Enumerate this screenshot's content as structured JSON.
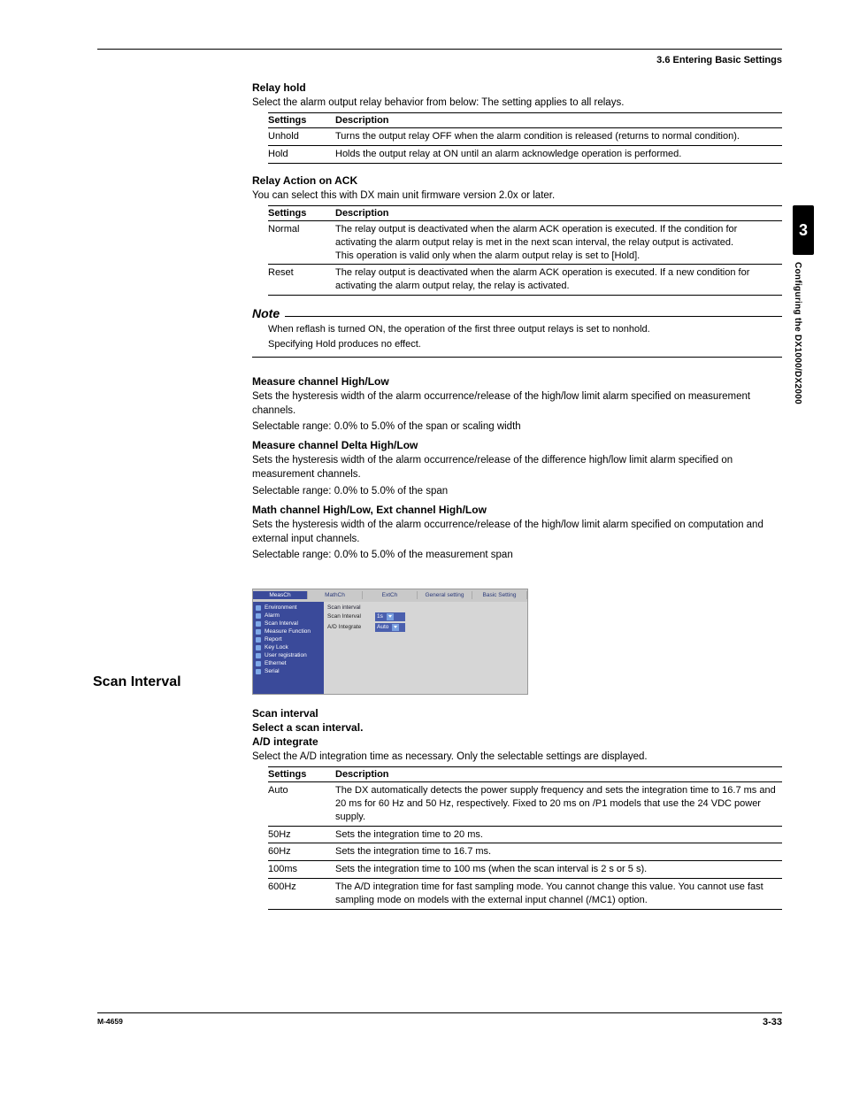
{
  "header": {
    "section": "3.6  Entering Basic Settings"
  },
  "chapter": {
    "num": "3",
    "sideText": "Configuring the DX1000/DX2000"
  },
  "relayHold": {
    "title": "Relay hold",
    "intro": "Select the alarm output relay behavior from below: The setting applies to all relays.",
    "cols": {
      "a": "Settings",
      "b": "Description"
    },
    "rows": [
      {
        "a": "Unhold",
        "b": "Turns the output relay OFF when the alarm condition is released (returns to normal condition)."
      },
      {
        "a": "Hold",
        "b": "Holds the output relay at ON until an alarm acknowledge operation is performed."
      }
    ]
  },
  "relayAck": {
    "title": "Relay Action on ACK",
    "intro": "You can select this with DX main unit firmware version 2.0x or later.",
    "cols": {
      "a": "Settings",
      "b": "Description"
    },
    "rows": [
      {
        "a": "Normal",
        "b": "The relay output is deactivated when the alarm ACK operation is executed. If the condition for activating the alarm output relay is met in the next scan interval, the relay output is activated.\nThis operation is valid only when the alarm output relay is set to [Hold]."
      },
      {
        "a": "Reset",
        "b": "The relay output is deactivated when the alarm ACK operation is executed. If a new condition for activating the alarm output relay, the relay is activated."
      }
    ]
  },
  "note": {
    "label": "Note",
    "line1": "When reflash is turned ON, the operation of the first three output relays is set to nonhold.",
    "line2": "Specifying Hold produces no effect."
  },
  "measHL": {
    "title": "Measure channel High/Low",
    "p1": "Sets the hysteresis width of the alarm occurrence/release of the high/low limit alarm specified on measurement channels.",
    "p2": "Selectable range: 0.0% to 5.0% of the span or scaling width"
  },
  "measDHL": {
    "title": "Measure channel Delta High/Low",
    "p1": "Sets the hysteresis width of the alarm occurrence/release of the difference high/low limit alarm specified on measurement channels.",
    "p2": "Selectable range: 0.0% to 5.0% of the span"
  },
  "mathHL": {
    "title": "Math channel High/Low, Ext channel High/Low",
    "p1": "Sets the hysteresis width of the alarm occurrence/release of the high/low limit alarm specified on computation and external input channels.",
    "p2": "Selectable range: 0.0% to 5.0% of the measurement span"
  },
  "scan": {
    "heading": "Scan Interval",
    "shot": {
      "tabs": [
        "MeasCh",
        "MathCh",
        "ExtCh",
        "General setting",
        "Basic Setting"
      ],
      "activeTab": 0,
      "side": [
        "Environment",
        "Alarm",
        "Scan Interval",
        "Measure Function",
        "Report",
        "Key Lock",
        "User registration",
        "Ethernet",
        "Serial"
      ],
      "group": "Scan interval",
      "rows": [
        {
          "label": "Scan Interval",
          "value": "1s"
        },
        {
          "label": "A/D Integrate",
          "value": "Auto"
        }
      ]
    },
    "sub1": "Scan interval",
    "sub2": "Select a scan interval.",
    "sub3": "A/D integrate",
    "intro": "Select the A/D integration time as necessary.  Only the selectable settings are displayed.",
    "cols": {
      "a": "Settings",
      "b": "Description"
    },
    "rows": [
      {
        "a": "Auto",
        "b": "The DX automatically detects the power supply frequency and sets the integration time to 16.7 ms and 20 ms for 60 Hz and 50 Hz, respectively. Fixed to 20 ms on /P1 models that use the 24 VDC power supply."
      },
      {
        "a": "50Hz",
        "b": "Sets the integration time to 20 ms."
      },
      {
        "a": "60Hz",
        "b": "Sets the integration time to 16.7 ms."
      },
      {
        "a": "100ms",
        "b": "Sets the integration time to 100 ms (when the scan interval is 2 s or 5 s)."
      },
      {
        "a": "600Hz",
        "b": "The A/D integration time for fast sampling mode.  You cannot change this value.  You cannot use fast sampling mode on models with the external input channel (/MC1) option."
      }
    ]
  },
  "footer": {
    "left": "M-4659",
    "right": "3-33"
  }
}
